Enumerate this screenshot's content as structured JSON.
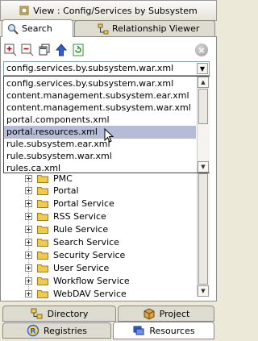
{
  "title": {
    "text": "View : Config/Services by Subsystem",
    "icon": "view-icon"
  },
  "top_tabs": [
    {
      "label": "Search",
      "icon": "magnifier-icon",
      "active": true
    },
    {
      "label": "Relationship Viewer",
      "icon": "relationship-icon",
      "active": false
    }
  ],
  "toolbar": {
    "buttons": [
      {
        "name": "expand-all-button",
        "icon": "expand-all-icon"
      },
      {
        "name": "collapse-all-button",
        "icon": "collapse-all-icon"
      },
      {
        "name": "copy-button",
        "icon": "copy-icon"
      },
      {
        "name": "up-button",
        "icon": "up-arrow-icon"
      },
      {
        "name": "refresh-button",
        "icon": "refresh-icon"
      }
    ],
    "stop_label": "×",
    "stop_icon": "stop-icon"
  },
  "combo": {
    "value": "config.services.by.subsystem.war.xml"
  },
  "dropdown": {
    "options": [
      "config.services.by.subsystem.war.xml",
      "content.management.subsystem.ear.xml",
      "content.management.subsystem.war.xml",
      "portal.components.xml",
      "portal.resources.xml",
      "rule.subsystem.ear.xml",
      "rule.subsystem.war.xml",
      "rules.ca.xml"
    ],
    "selected": "portal.resources.xml"
  },
  "tree": {
    "items": [
      "PMC",
      "Portal",
      "Portal Service",
      "RSS Service",
      "Rule Service",
      "Search Service",
      "Security Service",
      "User Service",
      "Workflow Service",
      "WebDAV Service"
    ]
  },
  "bottom_tabs": [
    {
      "label": "Directory",
      "icon": "directory-icon",
      "active": false
    },
    {
      "label": "Project",
      "icon": "project-box-icon",
      "active": false
    },
    {
      "label": "Registries",
      "icon": "registries-icon",
      "active": false
    },
    {
      "label": "Resources",
      "icon": "resources-icon",
      "active": true
    }
  ],
  "colors": {
    "selection": "#b7bcd6",
    "panel_bg": "#ece9d8",
    "folder": "#f2c94c"
  }
}
